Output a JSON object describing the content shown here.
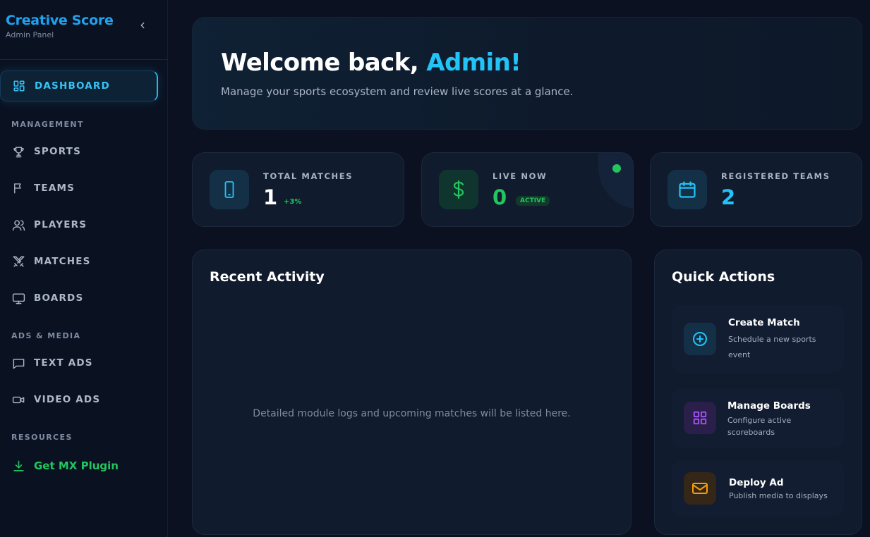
{
  "sidebar": {
    "brand_title": "Creative Score",
    "brand_subtitle": "Admin Panel",
    "collapse_glyph": "‹",
    "dashboard_label": "DASHBOARD",
    "sections": {
      "management": "MANAGEMENT",
      "ads_media": "ADS & MEDIA",
      "resources": "RESOURCES"
    },
    "items": {
      "sports": "SPORTS",
      "teams": "TEAMS",
      "players": "PLAYERS",
      "matches": "MATCHES",
      "boards": "BOARDS",
      "text_ads": "TEXT ADS",
      "video_ads": "VIDEO ADS",
      "plugin": "Get MX Plugin"
    },
    "icons": {
      "dashboard": "grid-icon",
      "sports": "trophy-icon",
      "teams": "flag-icon",
      "players": "users-icon",
      "matches": "swords-icon",
      "boards": "monitor-icon",
      "text_ads": "message-icon",
      "video_ads": "video-icon",
      "plugin": "download-icon"
    }
  },
  "hero": {
    "title_prefix": "Welcome back, ",
    "title_name": "Admin!",
    "subtitle": "Manage your sports ecosystem and review live scores at a glance."
  },
  "stats": {
    "total_matches": {
      "label": "TOTAL MATCHES",
      "value": "1",
      "change": "+3%"
    },
    "live_now": {
      "label": "LIVE NOW",
      "value": "0",
      "badge": "ACTIVE"
    },
    "registered_teams": {
      "label": "REGISTERED TEAMS",
      "value": "2"
    }
  },
  "recent_activity": {
    "title": "Recent Activity",
    "empty_message": "Detailed module logs and upcoming matches will be listed here."
  },
  "quick_actions": {
    "title": "Quick Actions",
    "create_match": {
      "title": "Create Match",
      "desc_line1": "Schedule a new sports",
      "desc_line2": "event"
    },
    "manage_boards": {
      "title": "Manage Boards",
      "desc_line1": "Configure active",
      "desc_line2": "scoreboards"
    },
    "deploy_ad": {
      "title": "Deploy Ad",
      "desc_line1": "Publish media to displays"
    }
  },
  "colors": {
    "brand": "#1fa3f0",
    "accent_cyan": "#22c3f7",
    "live_green": "#22c55e",
    "purple": "#a855f7",
    "orange": "#f59e0b",
    "background": "#0b1120"
  }
}
